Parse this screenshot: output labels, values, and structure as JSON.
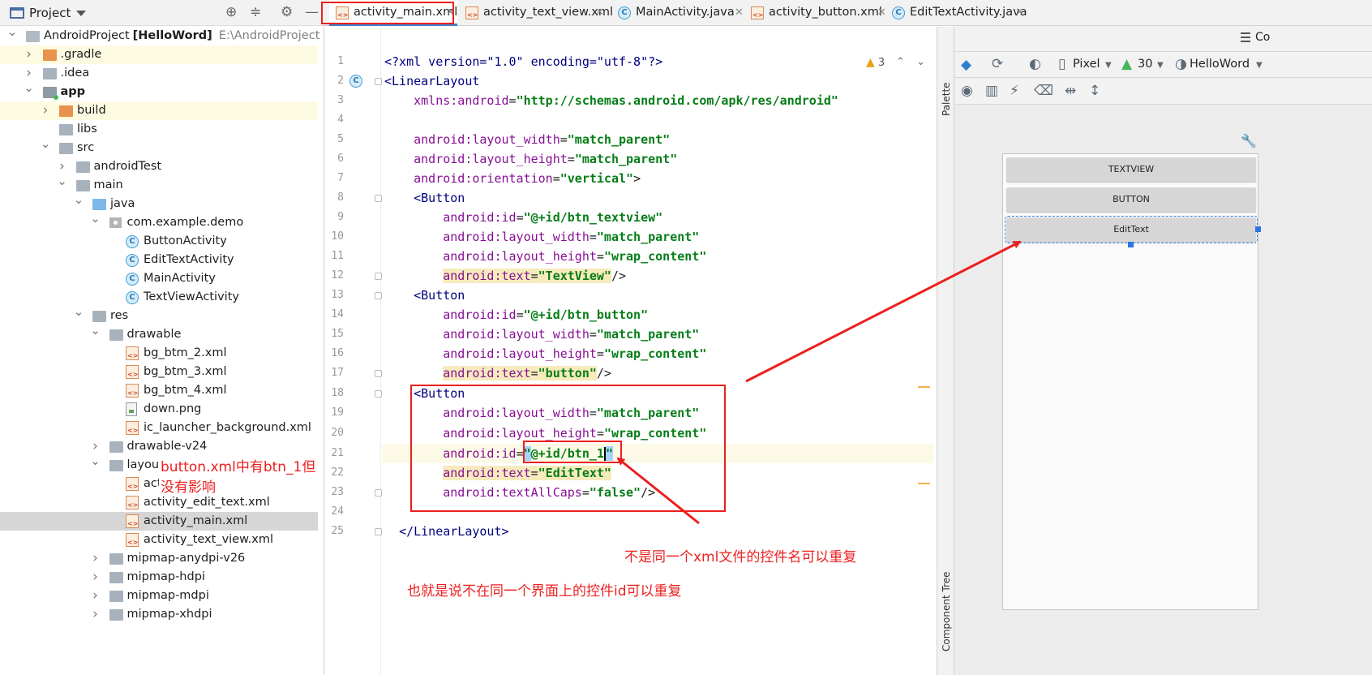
{
  "project": {
    "title": "Project",
    "tree": [
      {
        "label": "AndroidProject",
        "bold_suffix": "[HelloWord]",
        "dim": "E:\\AndroidProject",
        "icon": "module-icon"
      },
      {
        "label": ".gradle",
        "icon": "folder-icon-orange"
      },
      {
        "label": ".idea",
        "icon": "folder-icon"
      },
      {
        "label": "app",
        "icon": "app-module-icon"
      },
      {
        "label": "build",
        "icon": "folder-icon-orange"
      },
      {
        "label": "libs",
        "icon": "folder-icon"
      },
      {
        "label": "src",
        "icon": "folder-icon"
      },
      {
        "label": "androidTest",
        "icon": "folder-icon"
      },
      {
        "label": "main",
        "icon": "folder-icon"
      },
      {
        "label": "java",
        "icon": "folder-icon-blue"
      },
      {
        "label": "com.example.demo",
        "icon": "package-icon"
      },
      {
        "label": "ButtonActivity",
        "icon": "class-icon"
      },
      {
        "label": "EditTextActivity",
        "icon": "class-icon"
      },
      {
        "label": "MainActivity",
        "icon": "class-icon"
      },
      {
        "label": "TextViewActivity",
        "icon": "class-icon"
      },
      {
        "label": "res",
        "icon": "folder-icon"
      },
      {
        "label": "drawable",
        "icon": "folder-icon"
      },
      {
        "label": "bg_btm_2.xml",
        "icon": "xml-file-icon"
      },
      {
        "label": "bg_btm_3.xml",
        "icon": "xml-file-icon"
      },
      {
        "label": "bg_btm_4.xml",
        "icon": "xml-file-icon"
      },
      {
        "label": "down.png",
        "icon": "png-file-icon"
      },
      {
        "label": "ic_launcher_background.xml",
        "icon": "xml-file-icon"
      },
      {
        "label": "drawable-v24",
        "icon": "folder-icon"
      },
      {
        "label": "layout",
        "icon": "folder-icon"
      },
      {
        "label": "activity_button.xml",
        "icon": "xml-file-icon"
      },
      {
        "label": "activity_edit_text.xml",
        "icon": "xml-file-icon"
      },
      {
        "label": "activity_main.xml",
        "icon": "xml-file-icon"
      },
      {
        "label": "activity_text_view.xml",
        "icon": "xml-file-icon"
      },
      {
        "label": "mipmap-anydpi-v26",
        "icon": "folder-icon"
      },
      {
        "label": "mipmap-hdpi",
        "icon": "folder-icon"
      },
      {
        "label": "mipmap-mdpi",
        "icon": "folder-icon"
      },
      {
        "label": "mipmap-xhdpi",
        "icon": "folder-icon"
      }
    ],
    "annotation": "button.xml中有btn_1但没有影响"
  },
  "tabs": [
    {
      "label": "activity_main.xml",
      "icon": "xml",
      "active": true
    },
    {
      "label": "activity_text_view.xml",
      "icon": "xml",
      "active": false
    },
    {
      "label": "MainActivity.java",
      "icon": "cls",
      "active": false
    },
    {
      "label": "activity_button.xml",
      "icon": "xml",
      "active": false
    },
    {
      "label": "EditTextActivity.java",
      "icon": "cls",
      "active": false
    }
  ],
  "editor": {
    "warnings": "3",
    "lines": [
      "1",
      "2",
      "3",
      "4",
      "5",
      "6",
      "7",
      "8",
      "9",
      "10",
      "11",
      "12",
      "13",
      "14",
      "15",
      "16",
      "17",
      "18",
      "19",
      "20",
      "21",
      "22",
      "23",
      "24",
      "25"
    ],
    "code": {
      "l1": "<?xml version=\"1.0\" encoding=\"utf-8\"?>",
      "l2_tag": "<LinearLayout",
      "l3_ns": "xmlns:android",
      "l3_val": "\"http://schemas.android.com/apk/res/android\"",
      "l5_attr": "android:layout_width",
      "l5_val": "\"match_parent\"",
      "l6_attr": "android:layout_height",
      "l6_val": "\"match_parent\"",
      "l7_attr": "android:orientation",
      "l7_val": "\"vertical\"",
      "button_tag": "<Button",
      "l9_attr": "android:id",
      "l9_val": "\"@+id/btn_textview\"",
      "width_attr": "android:layout_width",
      "width_val": "\"match_parent\"",
      "height_attr": "android:layout_height",
      "height_val": "\"wrap_content\"",
      "text_attr": "android:text",
      "l12_val": "\"TextView\"",
      "l14_val": "\"@+id/btn_button\"",
      "l17_val": "\"button\"",
      "l21_val_a": "\"",
      "l21_val_b": "@+id/btn_1",
      "l21_val_c": "\"",
      "l22_val": "\"EditText\"",
      "l23_attr": "android:textAllCaps",
      "l23_val": "\"false\"",
      "l25_tag": "</LinearLayout>"
    }
  },
  "annotations": {
    "a1": "不是同一个xml文件的控件名可以重复",
    "a2": "也就是说不在同一个界面上的控件id可以重复"
  },
  "side": {
    "palette": "Palette",
    "component_tree": "Component Tree"
  },
  "design": {
    "top_right": "Co",
    "device": "Pixel",
    "api": "30",
    "theme": "HelloWord",
    "preview_buttons": [
      "TEXTVIEW",
      "BUTTON",
      "EditText"
    ]
  }
}
